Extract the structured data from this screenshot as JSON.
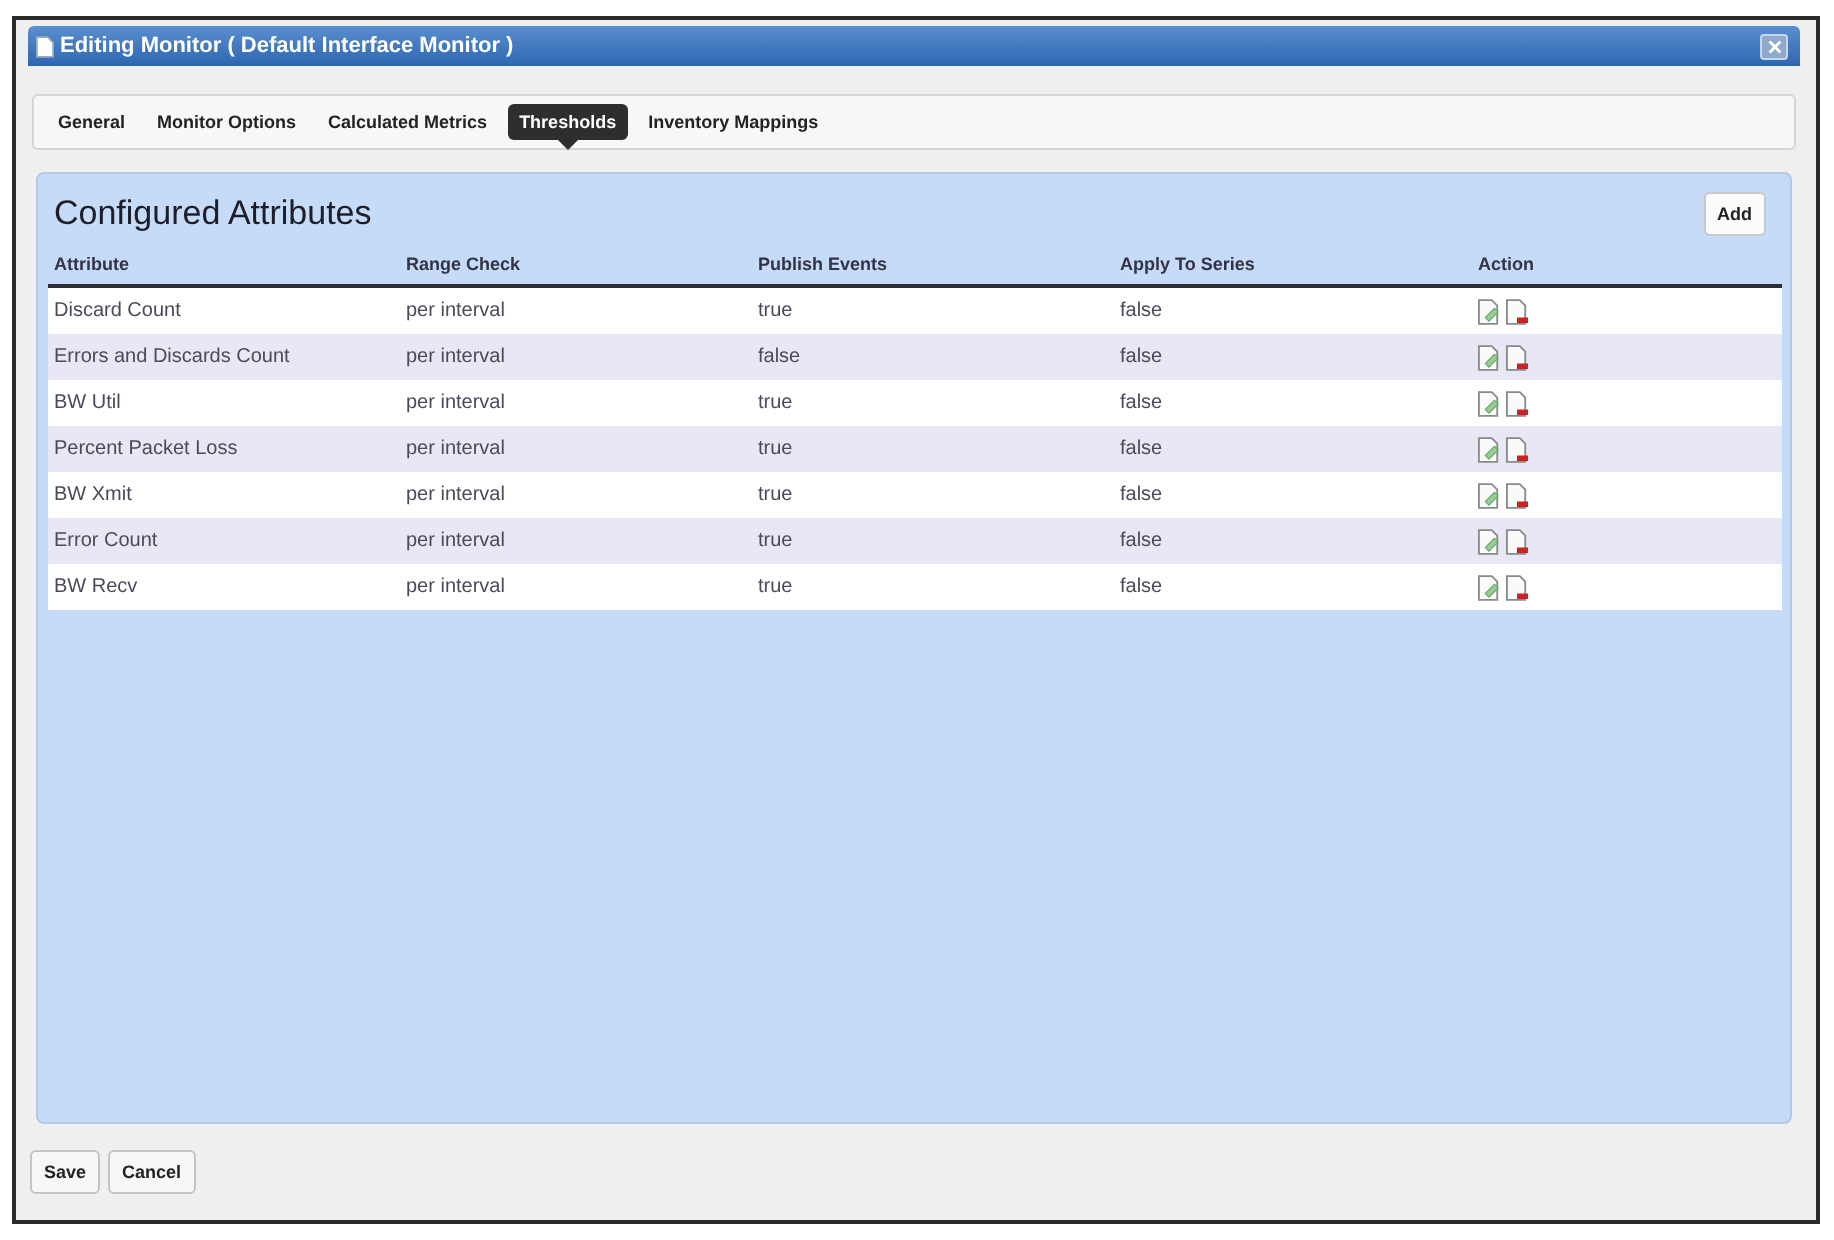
{
  "window": {
    "title": "Editing Monitor ( Default Interface Monitor )"
  },
  "tabs": [
    {
      "label": "General",
      "selected": false
    },
    {
      "label": "Monitor Options",
      "selected": false
    },
    {
      "label": "Calculated Metrics",
      "selected": false
    },
    {
      "label": "Thresholds",
      "selected": true
    },
    {
      "label": "Inventory Mappings",
      "selected": false
    }
  ],
  "panel": {
    "title": "Configured Attributes",
    "add_button": "Add"
  },
  "table": {
    "columns": [
      "Attribute",
      "Range Check",
      "Publish Events",
      "Apply To Series",
      "Action"
    ],
    "rows": [
      {
        "cells": [
          "Discard Count",
          "per interval",
          "true",
          "false"
        ]
      },
      {
        "cells": [
          "Errors and Discards Count",
          "per interval",
          "false",
          "false"
        ]
      },
      {
        "cells": [
          "BW Util",
          "per interval",
          "true",
          "false"
        ]
      },
      {
        "cells": [
          "Percent Packet Loss",
          "per interval",
          "true",
          "false"
        ]
      },
      {
        "cells": [
          "BW Xmit",
          "per interval",
          "true",
          "false"
        ]
      },
      {
        "cells": [
          "Error Count",
          "per interval",
          "true",
          "false"
        ]
      },
      {
        "cells": [
          "BW Recv",
          "per interval",
          "true",
          "false"
        ]
      }
    ]
  },
  "buttons": [
    "Save",
    "Cancel"
  ]
}
